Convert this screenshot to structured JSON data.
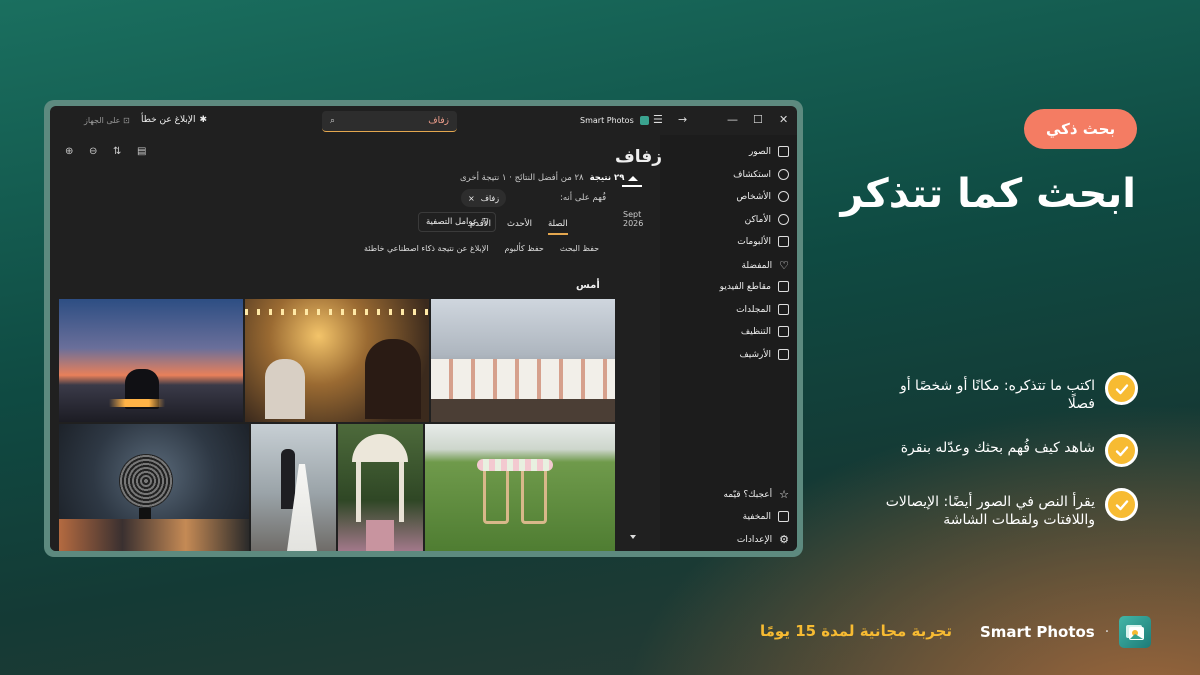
{
  "promo": {
    "badge": "بحث ذكي",
    "headline": "ابحث كما تتذكر",
    "features": [
      "اكتب ما تتذكره: مكانًا أو شخصًا أو فصلًا",
      "شاهد كيف فُهم بحثك وعدّله بنقرة",
      "يقرأ النص في الصور أيضًا: الإيصالات واللافتات ولقطات الشاشة"
    ],
    "brand_name": "Smart Photos",
    "separator": "·",
    "trial": "تجربة مجانية لمدة 15 يومًا"
  },
  "window": {
    "app_title": "Smart Photos",
    "search_query": "زفاف",
    "report_label": "الإبلاغ عن خطأ",
    "device_label": "على الجهاز",
    "sidebar_top": [
      "الصور",
      "استكشاف",
      "الأشخاص",
      "الأماكن",
      "الألبومات",
      "المفضلة",
      "مقاطع الفيديو",
      "المجلدات",
      "التنظيف",
      "الأرشيف"
    ],
    "sidebar_bottom": [
      "أعجبك؟ قيّمه",
      "المخفية",
      "الإعدادات"
    ],
    "page_title": "زفاف",
    "timeline_label": "Sept 2026",
    "results_count": "٢٩ نتيجة",
    "results_detail": "٢٨ من أفضل النتائج · ١ نتيجة أخرى",
    "understood_label": "فُهم على أنه:",
    "chip_label": "زفاف",
    "chip_close": "×",
    "tabs": [
      "الصلة",
      "الأحدث",
      "الأقدم"
    ],
    "filter_label": "عوامل التصفية",
    "actions": [
      "حفظ البحث",
      "حفظ كألبوم",
      "الإبلاغ عن نتيجة ذكاء اصطناعي خاطئة"
    ],
    "section_title": "أمس"
  },
  "colors": {
    "accent": "#e4a74f",
    "badge": "#f47c63",
    "check": "#f7bb32"
  }
}
